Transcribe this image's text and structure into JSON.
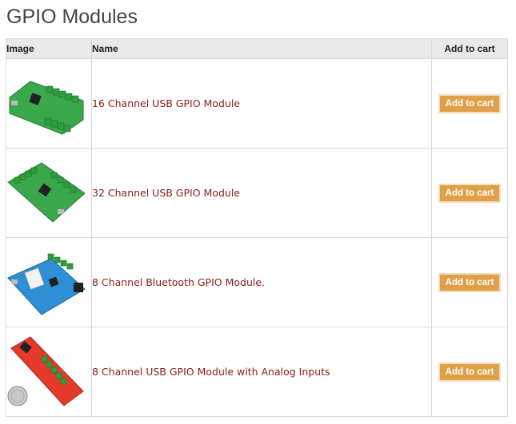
{
  "page": {
    "title": "GPIO Modules"
  },
  "table": {
    "headers": {
      "image": "Image",
      "name": "Name",
      "add": "Add to cart"
    },
    "rows": [
      {
        "name": "16 Channel USB GPIO Module",
        "button": "Add to cart",
        "image_icon": "usb-gpio-16-board-image"
      },
      {
        "name": "32 Channel USB GPIO Module",
        "button": "Add to cart",
        "image_icon": "usb-gpio-32-board-image"
      },
      {
        "name": "8 Channel Bluetooth GPIO Module.",
        "button": "Add to cart",
        "image_icon": "bluetooth-gpio-8-board-image"
      },
      {
        "name": "8 Channel USB GPIO Module with Analog Inputs",
        "button": "Add to cart",
        "image_icon": "usb-gpio-8-analog-board-image"
      }
    ]
  },
  "colors": {
    "title": "#444444",
    "link": "#8b1a1a",
    "header_bg": "#e9e9e9",
    "button_bg": "#e0a048",
    "border": "#d6d6d6"
  }
}
